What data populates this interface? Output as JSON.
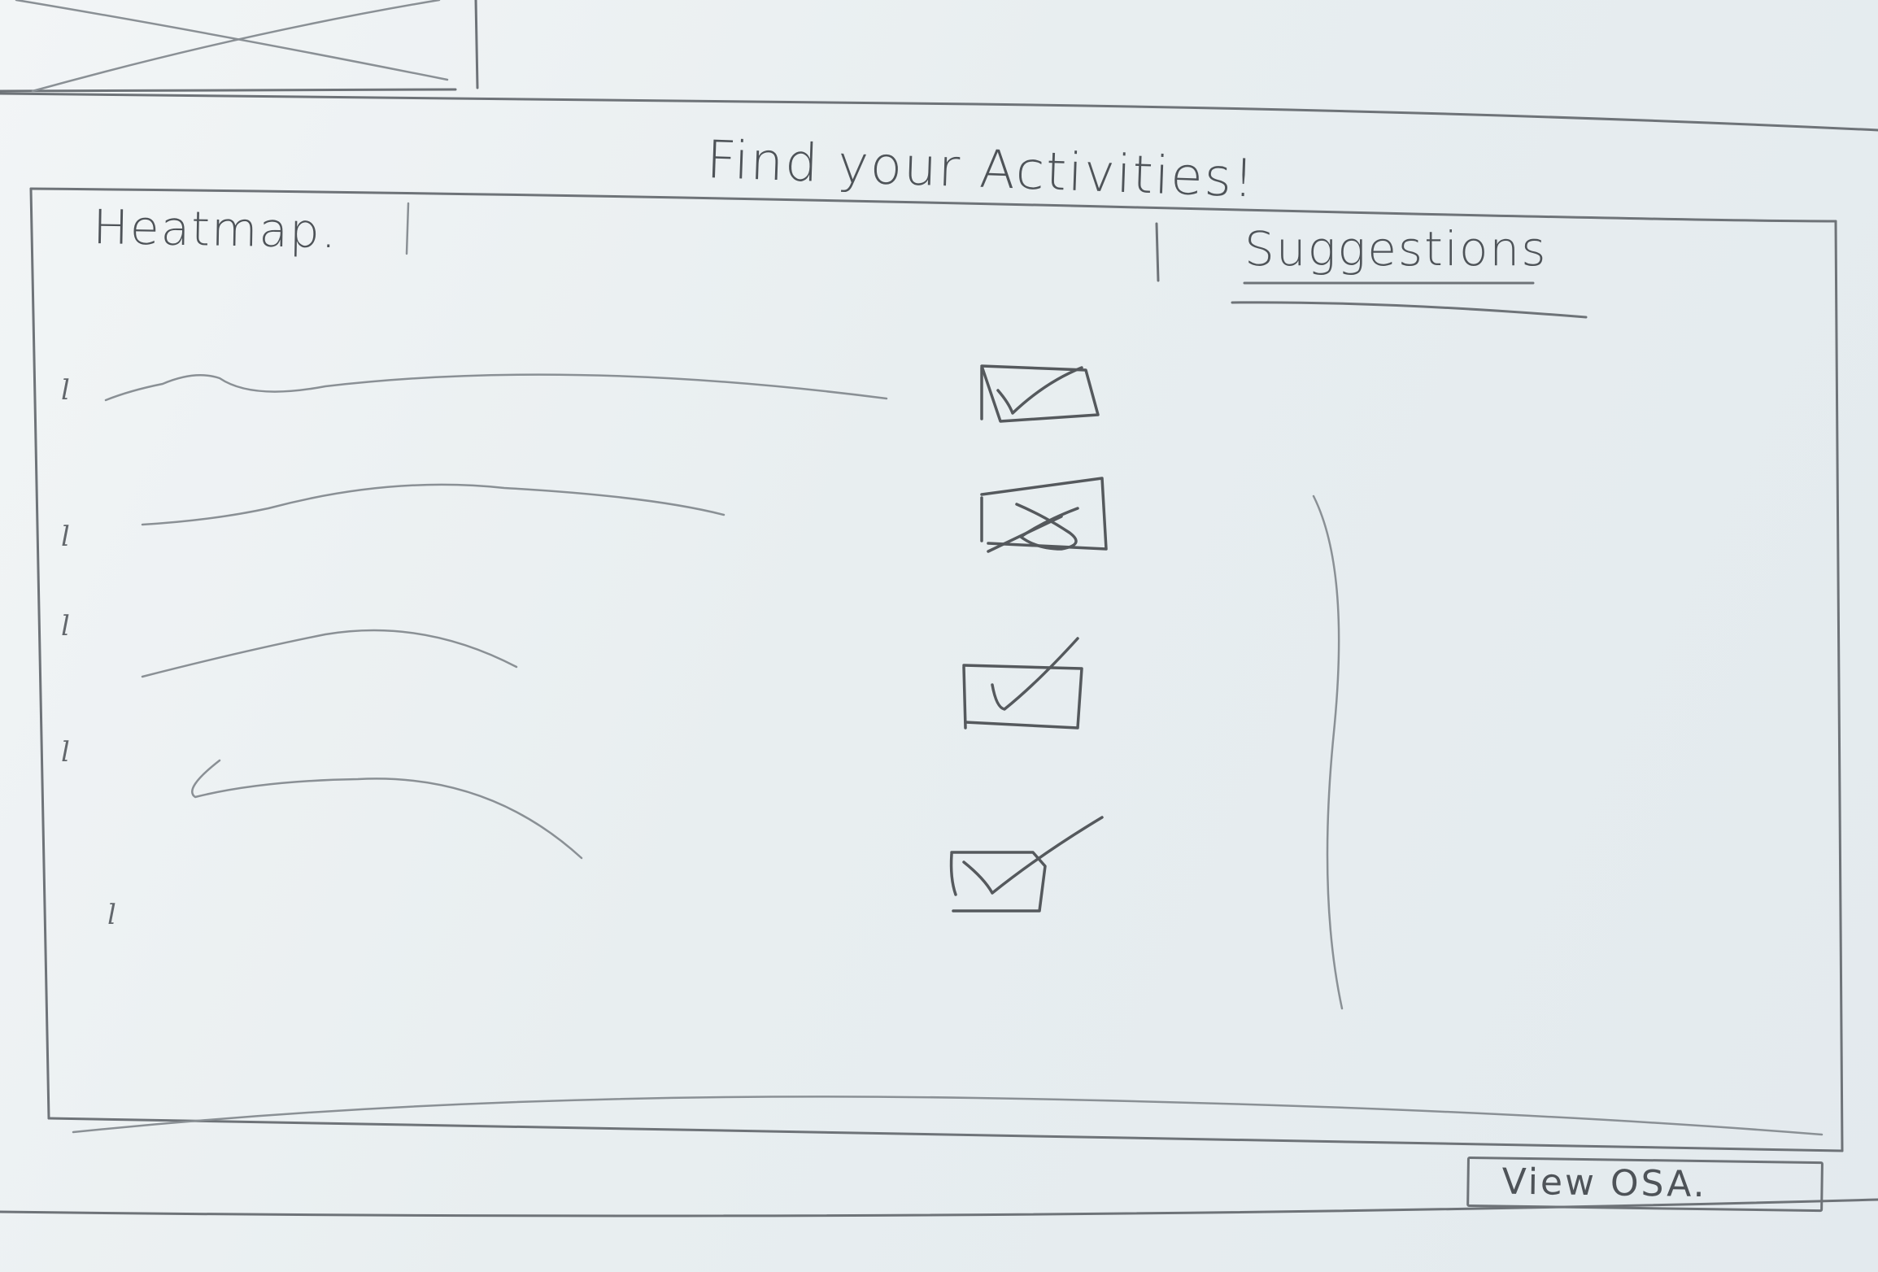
{
  "page": {
    "title": "Find your Activities!"
  },
  "heatmap": {
    "label": "Heatmap."
  },
  "suggestions": {
    "label": "Suggestions"
  },
  "activities": [
    {
      "marker": "l",
      "state": "checked"
    },
    {
      "marker": "l",
      "state": "crossed"
    },
    {
      "marker": "l",
      "state": "checked"
    },
    {
      "marker": "l",
      "state": "checked"
    },
    {
      "marker": "l",
      "state": "none"
    }
  ],
  "footer": {
    "view_button_label": "View OSA."
  }
}
